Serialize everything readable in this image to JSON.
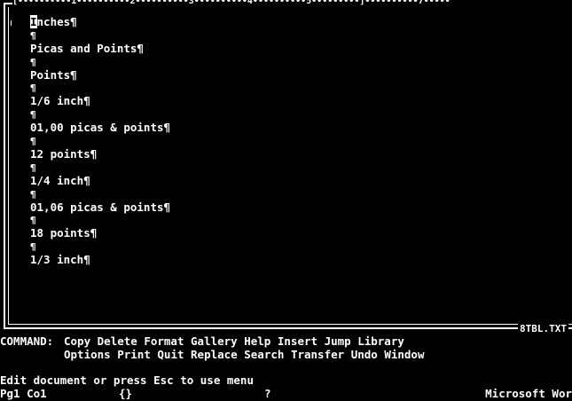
{
  "ruler": "[••••••••••1••••••••••2••••••••••3••••••••••4••••••••••5•••••••••]••••••••••7•••••",
  "document": {
    "cursor_char": "I",
    "lines": [
      {
        "text": "nches¶"
      },
      {
        "text": "¶"
      },
      {
        "text": "Picas and Points¶"
      },
      {
        "text": "¶"
      },
      {
        "text": "Points¶"
      },
      {
        "text": "¶"
      },
      {
        "text": "1/6 inch¶"
      },
      {
        "text": "¶"
      },
      {
        "text": "01,00 picas & points¶"
      },
      {
        "text": "¶"
      },
      {
        "text": "12 points¶"
      },
      {
        "text": "¶"
      },
      {
        "text": "1/4 inch¶"
      },
      {
        "text": "¶"
      },
      {
        "text": "01,06 picas & points¶"
      },
      {
        "text": "¶"
      },
      {
        "text": "18 points¶"
      },
      {
        "text": "¶"
      },
      {
        "text": "1/3 inch¶"
      }
    ]
  },
  "filename": "8TBL.TXT",
  "command_menu": {
    "label": "COMMAND:",
    "row1": [
      "Copy",
      "Delete",
      "Format",
      "Gallery",
      "Help",
      "Insert",
      "Jump",
      "Library"
    ],
    "row2": [
      "Options",
      "Print",
      "Quit",
      "Replace",
      "Search",
      "Transfer",
      "Undo",
      "Window"
    ]
  },
  "status": {
    "message": "Edit document or press Esc to use menu",
    "position": "Pg1 Co1",
    "brackets": "{}",
    "question": "?",
    "app_name": "Microsoft Wor"
  }
}
